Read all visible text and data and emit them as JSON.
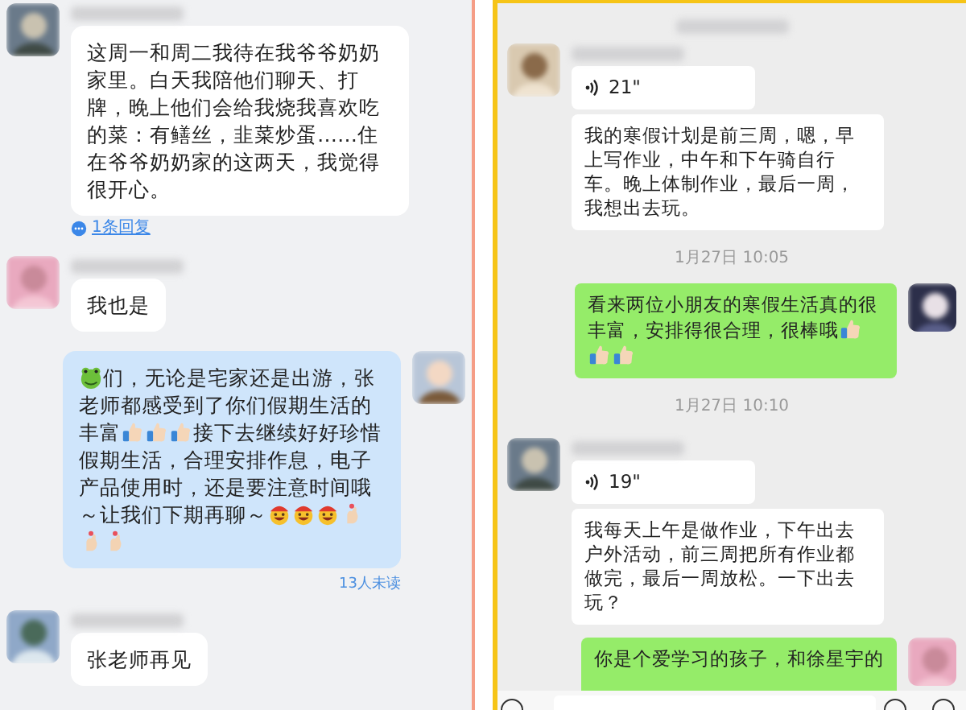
{
  "panels": [
    {
      "header_blurred": false,
      "messages": [
        {
          "kind": "incoming",
          "avatar": true,
          "parts": [
            {
              "kind": "text",
              "text": "这周一和周二我待在我爷爷奶奶家里。白天我陪他们聊天、打牌，晚上他们会给我烧我喜欢吃的菜：有鳝丝，韭菜炒蛋……住在爷爷奶奶家的这两天，我觉得很开心。"
            }
          ],
          "reply_link": "1条回复"
        },
        {
          "kind": "incoming",
          "avatar": true,
          "parts": [
            {
              "kind": "text",
              "text": "我也是"
            }
          ]
        },
        {
          "kind": "outgoing",
          "avatar": true,
          "parts": [
            {
              "kind": "frog"
            },
            {
              "kind": "text",
              "text": "们，无论是宅家还是出游，张老师都感受到了你们假期生活的丰富"
            },
            {
              "kind": "thumb"
            },
            {
              "kind": "thumb"
            },
            {
              "kind": "thumb"
            },
            {
              "kind": "text",
              "text": "接下去继续好好珍惜假期生活，合理安排作息，电子产品使用时，还是要注意时间哦～让我们下期再聊～"
            },
            {
              "kind": "grin"
            },
            {
              "kind": "grin"
            },
            {
              "kind": "grin"
            },
            {
              "kind": "heart-hand"
            },
            {
              "kind": "heart-hand"
            },
            {
              "kind": "heart-hand"
            }
          ],
          "read_status": "13人未读"
        },
        {
          "kind": "incoming",
          "avatar": true,
          "parts": [
            {
              "kind": "text",
              "text": "张老师再见"
            }
          ]
        }
      ]
    },
    {
      "header_blurred": true,
      "messages": [
        {
          "kind": "incoming",
          "avatar": true,
          "voice": "21\""
        },
        {
          "kind": "incoming",
          "avatar": false,
          "parts": [
            {
              "kind": "text",
              "text": "我的寒假计划是前三周，嗯，早上写作业，中午和下午骑自行车。晚上体制作业，最后一周，我想出去玩。"
            }
          ]
        },
        {
          "kind": "time",
          "text": "1月27日 10:05"
        },
        {
          "kind": "outgoing",
          "avatar": true,
          "parts": [
            {
              "kind": "text",
              "text": "看来两位小朋友的寒假生活真的很丰富，安排得很合理，很棒哦"
            },
            {
              "kind": "thumb"
            },
            {
              "kind": "thumb"
            },
            {
              "kind": "thumb"
            }
          ]
        },
        {
          "kind": "time",
          "text": "1月27日 10:10"
        },
        {
          "kind": "incoming",
          "avatar": true,
          "voice": "19\""
        },
        {
          "kind": "incoming",
          "avatar": false,
          "parts": [
            {
              "kind": "text",
              "text": "我每天上午是做作业，下午出去户外活动，前三周把所有作业都做完，最后一周放松。一下出去玩？"
            }
          ]
        },
        {
          "kind": "outgoing",
          "avatar": true,
          "parts": [
            {
              "kind": "text",
              "text": "你是个爱学习的孩子，和徐星宇的"
            }
          ]
        }
      ],
      "input_bar": true
    }
  ]
}
